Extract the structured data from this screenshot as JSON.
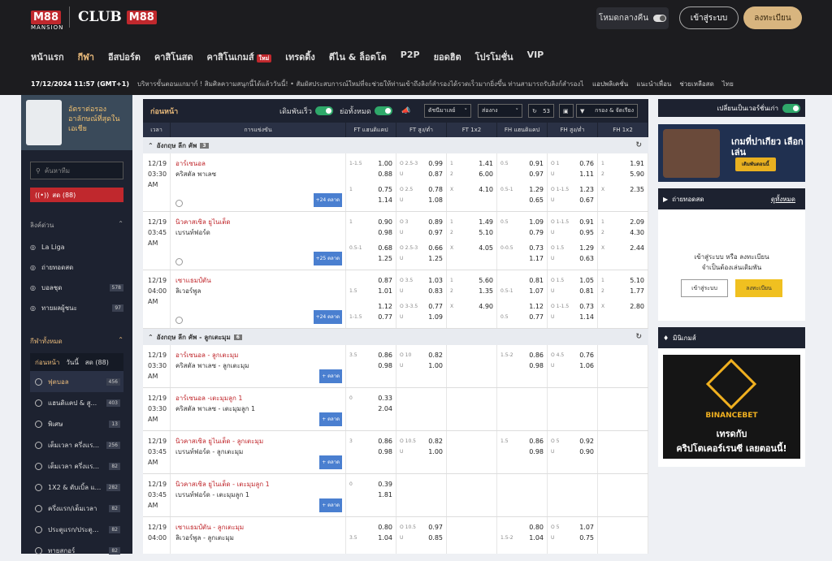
{
  "header": {
    "brand": "M88",
    "brand_sub": "MANSION",
    "club": "CLUB",
    "club_brand": "M88",
    "dark_mode": "โหมดกลางคืน",
    "login": "เข้าสู่ระบบ",
    "register": "ลงทะเบียน"
  },
  "nav": [
    "หน้าแรก",
    "กีฬา",
    "อีสปอร์ต",
    "คาสิโนสด",
    "คาสิโนเกมส์",
    "เทรดดิ้ง",
    "ตีไน & ล็อตโต",
    "P2P",
    "ยอดฮิต",
    "โปรโมชั่น",
    "VIP"
  ],
  "nav_hot": "ใหม่",
  "ticker": {
    "datetime": "17/12/2024 11:57 (GMT+1)",
    "msg": "บริหารขั้นตอนแกมาก์ ! สิมศิลความสนุกนี้ได้แล้ววันนี้! • สัมผัสประสบการณ์ใหม่ที่จะช่วยให้ท่านเข้าถึงลิงก์สำรองได้รวดเร็วมากยิ่งขึ้น ท่านสามารถรับลิงก์สำรองได้",
    "app": "แอปพลิเคชั่น",
    "refer": "แนะนำเพื่อน",
    "help": "ช่วยเหลือสด",
    "lang": "ไทย"
  },
  "left": {
    "promo": "อัตราต่อรองอาลักษณ์ที่สุดในเอเชีย",
    "search": "ค้นหาทีม",
    "live": "สด (88)",
    "quick_title": "ลิงค์ด่วน",
    "quick": [
      {
        "icon": "la-liga-icon",
        "label": "La Liga"
      },
      {
        "icon": "live-tv-icon",
        "label": "ถ่ายทอดสด"
      },
      {
        "icon": "ball-icon",
        "label": "บอลชุด",
        "count": "578"
      },
      {
        "icon": "trophy-icon",
        "label": "ทายผลผู้ชนะ",
        "count": "97"
      }
    ],
    "all_title": "กีฬาทั้งหมด",
    "tabs": [
      "ก่อนหน้า",
      "วันนี้",
      "สด (88)"
    ],
    "sports": [
      {
        "label": "ฟุตบอล",
        "count": "456"
      },
      {
        "label": "แฮนดิแคป & สู...",
        "count": "403"
      },
      {
        "label": "พิเศษ",
        "count": "13"
      },
      {
        "label": "เต็มเวลา ครึ่งแร...",
        "count": "256"
      },
      {
        "label": "เต็มเวลา ครึ่งแร...",
        "count": "82"
      },
      {
        "label": "1X2 & ดับเบิ้ล แ...",
        "count": "282"
      },
      {
        "label": "ครึ่งแรก/เต็มเวลา",
        "count": "82"
      },
      {
        "label": "ประตูแรก/ประตู...",
        "count": "82"
      },
      {
        "label": "ทายสกอร์",
        "count": "82"
      }
    ]
  },
  "main": {
    "title": "ก่อนหน้า",
    "quick_bet": "เดิมพันเร็ว",
    "all_odds": "ย่อทั้งหมด",
    "odds_type": "ดัชนีมาเลย์",
    "sort": "ส่องกง",
    "refresh": "53",
    "filter": "กรอง & จัดเรียง",
    "columns": [
      "เวลา",
      "การแข่งขัน",
      "FT แฮนดิแคป",
      "FT สูง/ต่ำ",
      "FT 1x2",
      "FH แฮนดิแคป",
      "FH สูง/ต่ำ",
      "FH 1x2"
    ],
    "leagues": [
      {
        "name": "อังกฤษ ลีก คัพ",
        "count": "3",
        "matches": [
          {
            "date": "12/19",
            "time": "03:30",
            "ampm": "AM",
            "home": "อาร์เซนอล",
            "away": "คริสตัล พาเลซ",
            "more": "+24 ตลาด",
            "lines": [
              [
                "1-1.5",
                "1.00",
                "O 2.5-3",
                "0.99",
                "1",
                "1.41",
                "0.5",
                "0.91",
                "O 1",
                "0.76",
                "1",
                "1.91"
              ],
              [
                "",
                "0.88",
                "U",
                "0.87",
                "2",
                "6.00",
                "",
                "0.97",
                "U",
                "1.11",
                "2",
                "5.90"
              ],
              [
                "1",
                "0.75",
                "O 2.5",
                "0.78",
                "X",
                "4.10",
                "0.5-1",
                "1.29",
                "O 1-1.5",
                "1.23",
                "X",
                "2.35"
              ],
              [
                "",
                "1.14",
                "U",
                "1.08",
                "",
                "",
                "",
                "0.65",
                "U",
                "0.67",
                "",
                ""
              ]
            ]
          },
          {
            "date": "12/19",
            "time": "03:45",
            "ampm": "AM",
            "home": "นิวคาสเซิล ยูไนเต็ด",
            "away": "เบรนท์ฟอร์ด",
            "more": "+25 ตลาด",
            "lines": [
              [
                "1",
                "0.90",
                "O 3",
                "0.89",
                "1",
                "1.49",
                "0.5",
                "1.09",
                "O 1-1.5",
                "0.91",
                "1",
                "2.09"
              ],
              [
                "",
                "0.98",
                "U",
                "0.97",
                "2",
                "5.10",
                "",
                "0.79",
                "U",
                "0.95",
                "2",
                "4.30"
              ],
              [
                "0.5-1",
                "0.68",
                "O 2.5-3",
                "0.66",
                "X",
                "4.05",
                "0-0.5",
                "0.73",
                "O 1.5",
                "1.29",
                "X",
                "2.44"
              ],
              [
                "",
                "1.25",
                "U",
                "1.25",
                "",
                "",
                "",
                "1.17",
                "U",
                "0.63",
                "",
                ""
              ]
            ]
          },
          {
            "date": "12/19",
            "time": "04:00",
            "ampm": "AM",
            "home": "เซาแธมป์ตัน",
            "away": "ลิเวอร์พูล",
            "more": "+24 ตลาด",
            "lines": [
              [
                "",
                "0.87",
                "O 3.5",
                "1.03",
                "1",
                "5.60",
                "",
                "0.81",
                "O 1.5",
                "1.05",
                "1",
                "5.10"
              ],
              [
                "1.5",
                "1.01",
                "U",
                "0.83",
                "2",
                "1.35",
                "0.5-1",
                "1.07",
                "U",
                "0.81",
                "2",
                "1.77"
              ],
              [
                "",
                "1.12",
                "O 3-3.5",
                "0.77",
                "X",
                "4.90",
                "",
                "1.12",
                "O 1-1.5",
                "0.73",
                "X",
                "2.80"
              ],
              [
                "1-1.5",
                "0.77",
                "U",
                "1.09",
                "",
                "",
                "0.5",
                "0.77",
                "U",
                "1.14",
                "",
                ""
              ]
            ]
          }
        ]
      },
      {
        "name": "อังกฤษ ลีก คัพ - ลูกเตะมุม",
        "count": "6",
        "matches": [
          {
            "date": "12/19",
            "time": "03:30",
            "ampm": "AM",
            "home": "อาร์เซนอล - ลูกเตะมุม",
            "away": "คริสตัล พาเลซ - ลูกเตะมุม",
            "more": "+ ตลาด",
            "lines": [
              [
                "3.5",
                "0.86",
                "O 10",
                "0.82",
                "",
                "",
                "1.5-2",
                "0.86",
                "O 4.5",
                "0.76",
                "",
                ""
              ],
              [
                "",
                "0.98",
                "U",
                "1.00",
                "",
                "",
                "",
                "0.98",
                "U",
                "1.06",
                "",
                ""
              ]
            ]
          },
          {
            "date": "12/19",
            "time": "03:30",
            "ampm": "AM",
            "home": "อาร์เซนอล -เตะมุมลูก 1",
            "away": "คริสตัล พาเลซ - เตะมุมลูก 1",
            "more": "+ ตลาด",
            "lines": [
              [
                "0",
                "0.33",
                "",
                "",
                "",
                "",
                "",
                "",
                "",
                "",
                "",
                ""
              ],
              [
                "",
                "2.04",
                "",
                "",
                "",
                "",
                "",
                "",
                "",
                "",
                "",
                ""
              ]
            ]
          },
          {
            "date": "12/19",
            "time": "03:45",
            "ampm": "AM",
            "home": "นิวคาสเซิล ยูไนเต็ด - ลูกเตะมุม",
            "away": "เบรนท์ฟอร์ด - ลูกเตะมุม",
            "more": "+ ตลาด",
            "lines": [
              [
                "3",
                "0.86",
                "O 10.5",
                "0.82",
                "",
                "",
                "1.5",
                "0.86",
                "O 5",
                "0.92",
                "",
                ""
              ],
              [
                "",
                "0.98",
                "U",
                "1.00",
                "",
                "",
                "",
                "0.98",
                "U",
                "0.90",
                "",
                ""
              ]
            ]
          },
          {
            "date": "12/19",
            "time": "03:45",
            "ampm": "AM",
            "home": "นิวคาสเซิล ยูไนเต็ด - เตะมุมลูก 1",
            "away": "เบรนท์ฟอร์ด - เตะมุมลูก 1",
            "more": "+ ตลาด",
            "lines": [
              [
                "0",
                "0.39",
                "",
                "",
                "",
                "",
                "",
                "",
                "",
                "",
                "",
                ""
              ],
              [
                "",
                "1.81",
                "",
                "",
                "",
                "",
                "",
                "",
                "",
                "",
                "",
                ""
              ]
            ]
          },
          {
            "date": "12/19",
            "time": "04:00",
            "ampm": "",
            "home": "เซาแธมป์ตัน - ลูกเตะมุม",
            "away": "ลิเวอร์พูล - ลูกเตะมุม",
            "more": "",
            "lines": [
              [
                "",
                "0.80",
                "O 10.5",
                "0.97",
                "",
                "",
                "",
                "0.80",
                "O 5",
                "1.07",
                "",
                ""
              ],
              [
                "3.5",
                "1.04",
                "U",
                "0.85",
                "",
                "",
                "1.5-2",
                "1.04",
                "U",
                "0.75",
                "",
                ""
              ]
            ]
          }
        ]
      }
    ]
  },
  "right": {
    "old_version": "เปลี่ยนเป็นเวอร์ชั่นเก่า",
    "banner_text": "เกมที่ปาเกียว เลือกเล่น",
    "banner_btn": "เดิมพันตอนนี้",
    "live_title": "ถ่ายทอดสด",
    "live_link": "ดูทั้งหมด",
    "login_msg1": "เข้าสู่ระบบ หรือ ลงทะเบียน",
    "login_msg2": "จำเป็นต้องเล่นเดิมพัน",
    "login_btn": "เข้าสู่ระบบ",
    "register_btn": "ลงทะเบียน",
    "mini_title": "มินิเกมส์",
    "game_brand": "BINANCEBET",
    "game_line1": "เทรดกับ",
    "game_line2": "คริปโตเคอร์เรนซี เลยตอนนี้!"
  }
}
